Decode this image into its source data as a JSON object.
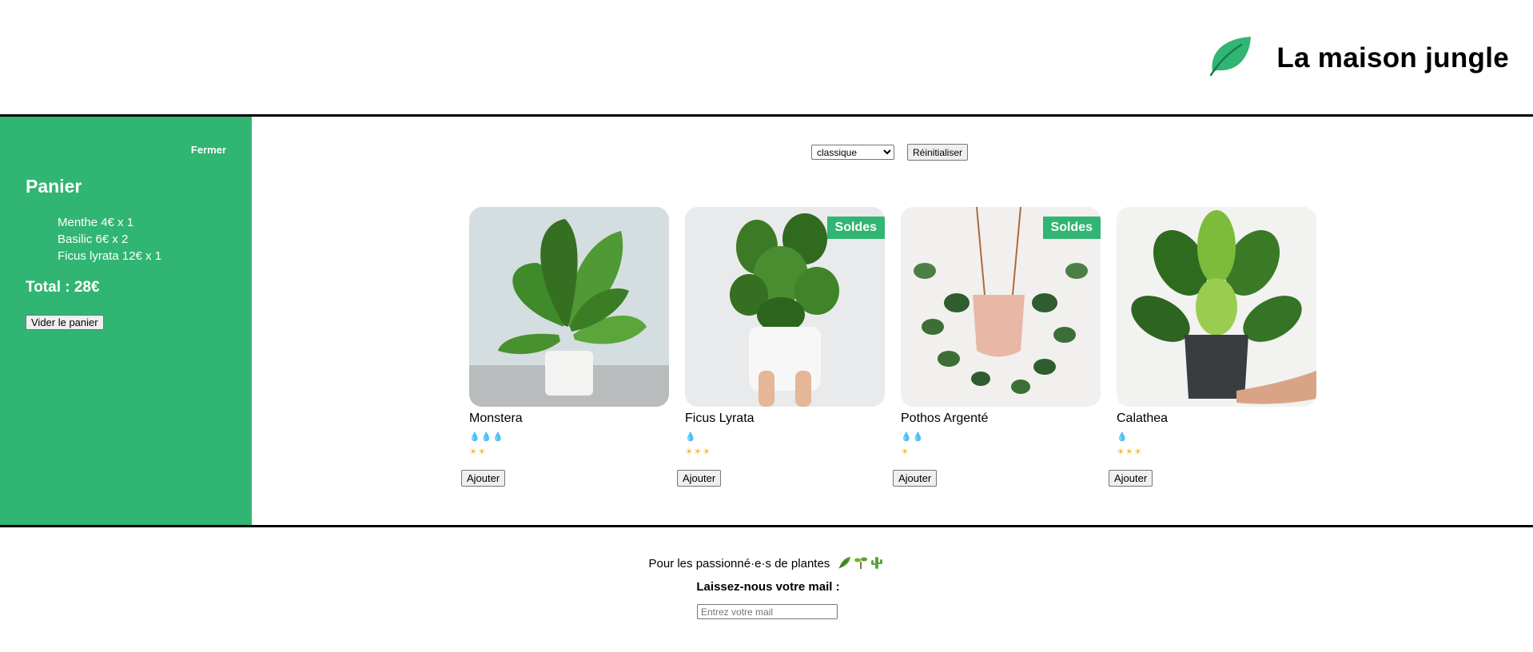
{
  "header": {
    "title": "La maison jungle",
    "logo_icon": "leaf-icon"
  },
  "sidebar": {
    "close_label": "Fermer",
    "title": "Panier",
    "items": [
      {
        "text": "Menthe 4€ x 1"
      },
      {
        "text": "Basilic 6€ x 2"
      },
      {
        "text": "Ficus lyrata 12€ x 1"
      }
    ],
    "total": "Total : 28€",
    "empty_label": "Vider le panier",
    "bg_color": "#31b572"
  },
  "toolbar": {
    "filter_value": "classique",
    "reset_label": "Réinitialiser"
  },
  "plants": [
    {
      "name": "Monstera",
      "water": 3,
      "light": 2,
      "sale": false,
      "add_label": "Ajouter"
    },
    {
      "name": "Ficus Lyrata",
      "water": 1,
      "light": 3,
      "sale": true,
      "sale_label": "Soldes",
      "add_label": "Ajouter"
    },
    {
      "name": "Pothos Argenté",
      "water": 2,
      "light": 1,
      "sale": true,
      "sale_label": "Soldes",
      "add_label": "Ajouter"
    },
    {
      "name": "Calathea",
      "water": 1,
      "light": 3,
      "sale": false,
      "add_label": "Ajouter"
    }
  ],
  "footer": {
    "tagline": "Pour les passionné·e·s de plantes",
    "tagline_icons": [
      "herb-icon",
      "seedling-icon",
      "cactus-icon"
    ],
    "ask": "Laissez-nous votre mail :",
    "email_placeholder": "Entrez votre mail"
  }
}
